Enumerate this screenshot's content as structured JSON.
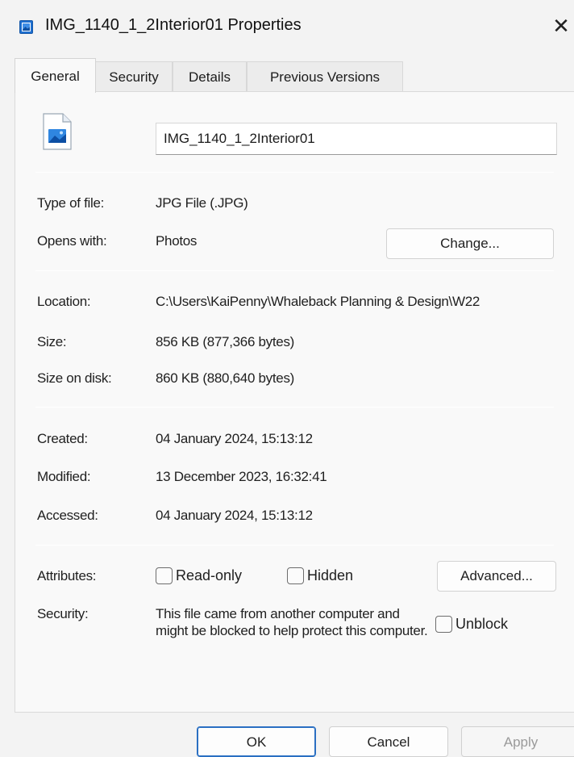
{
  "window": {
    "title": "IMG_1140_1_2Interior01 Properties",
    "close_glyph": "✕"
  },
  "tabs": [
    {
      "label": "General",
      "active": true
    },
    {
      "label": "Security",
      "active": false
    },
    {
      "label": "Details",
      "active": false
    },
    {
      "label": "Previous Versions",
      "active": false
    }
  ],
  "general": {
    "file_name": "IMG_1140_1_2Interior01",
    "type_label": "Type of file:",
    "type_value": "JPG File (.JPG)",
    "opens_label": "Opens with:",
    "opens_value": "Photos",
    "change_button": "Change...",
    "location_label": "Location:",
    "location_value": "C:\\Users\\KaiPenny\\Whaleback Planning & Design\\W22",
    "size_label": "Size:",
    "size_value": "856 KB (877,366 bytes)",
    "disk_label": "Size on disk:",
    "disk_value": "860 KB (880,640 bytes)",
    "created_label": "Created:",
    "created_value": "04 January 2024, 15:13:12",
    "modified_label": "Modified:",
    "modified_value": "13 December 2023, 16:32:41",
    "accessed_label": "Accessed:",
    "accessed_value": "04 January 2024, 15:13:12",
    "attributes_label": "Attributes:",
    "readonly_label": "Read-only",
    "readonly_checked": false,
    "hidden_label": "Hidden",
    "hidden_checked": false,
    "advanced_button": "Advanced...",
    "security_label": "Security:",
    "security_text": "This file came from another computer and might be blocked to help protect this computer.",
    "unblock_label": "Unblock",
    "unblock_checked": false
  },
  "footer": {
    "ok": "OK",
    "cancel": "Cancel",
    "apply": "Apply"
  },
  "colors": {
    "image_icon_blue": "#1e6fd0",
    "default_button_border": "#2a6fc2"
  },
  "icons": {
    "title": "image-file-icon",
    "file": "image-file-icon",
    "close": "close-icon"
  }
}
